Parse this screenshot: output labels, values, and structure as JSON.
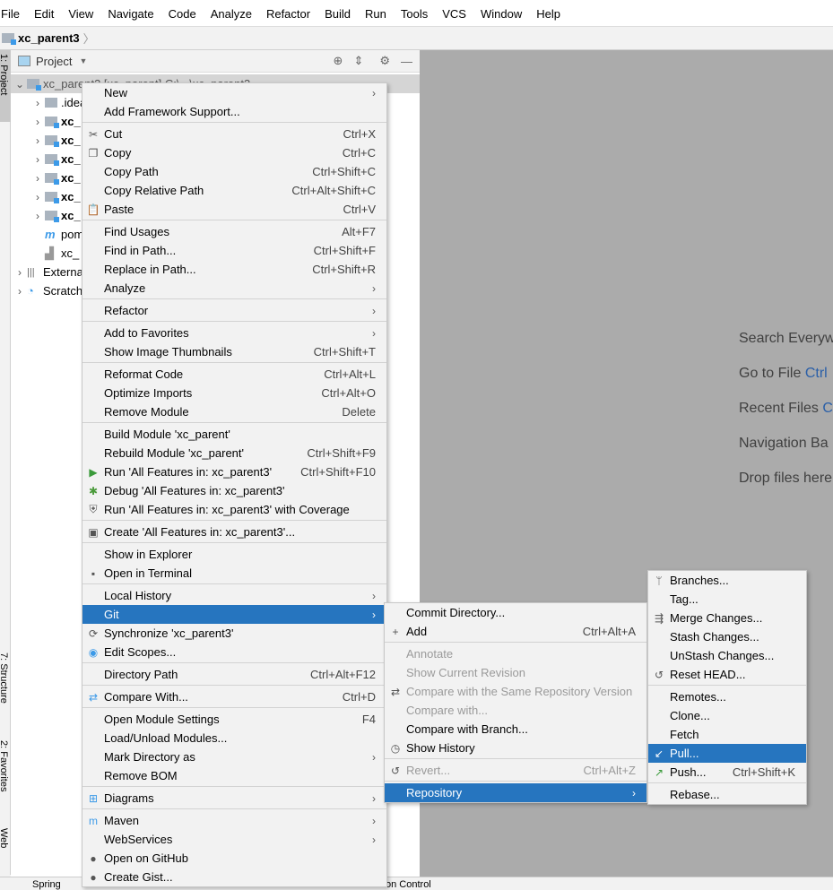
{
  "menubar": [
    "File",
    "Edit",
    "View",
    "Navigate",
    "Code",
    "Analyze",
    "Refactor",
    "Build",
    "Run",
    "Tools",
    "VCS",
    "Window",
    "Help"
  ],
  "breadcrumb": "xc_parent3",
  "left_strip": {
    "project": "1: Project",
    "structure": "7: Structure",
    "favorites": "2: Favorites",
    "web": "Web"
  },
  "project_panel": {
    "title": "Project",
    "tree": [
      {
        "label": "xc_parent3 [xc_parent] C:\\...\\xc_parent3",
        "expanded": true,
        "selected": true,
        "icon": "module-folder-icon"
      },
      {
        "label": ".idea",
        "icon": "folder-icon"
      },
      {
        "label": "xc_",
        "icon": "module-folder-icon",
        "bold": true
      },
      {
        "label": "xc_",
        "icon": "module-folder-icon",
        "bold": true
      },
      {
        "label": "xc_",
        "icon": "module-folder-icon",
        "bold": true
      },
      {
        "label": "xc_",
        "icon": "module-folder-icon",
        "bold": true
      },
      {
        "label": "xc_",
        "icon": "module-folder-icon",
        "bold": true
      },
      {
        "label": "xc_",
        "icon": "module-folder-icon",
        "bold": true
      },
      {
        "label": "pom",
        "icon": "maven-icon"
      },
      {
        "label": "xc_",
        "icon": "iml-file-icon"
      },
      {
        "label": "External",
        "icon": "library-icon",
        "root": true
      },
      {
        "label": "Scratch",
        "icon": "scratch-icon",
        "root": true
      }
    ]
  },
  "editor_hints": [
    {
      "text": "Search Everywhere",
      "key": ""
    },
    {
      "text": "Go to File ",
      "key": "Ctrl"
    },
    {
      "text": "Recent Files ",
      "key": "C"
    },
    {
      "text": "Navigation Ba",
      "key": ""
    },
    {
      "text": "Drop files here",
      "key": ""
    }
  ],
  "bottom": {
    "left": "Spring",
    "right": "on Control"
  },
  "context_menu": [
    {
      "label": "New",
      "sub": true
    },
    {
      "label": "Add Framework Support..."
    },
    {
      "sep": true
    },
    {
      "label": "Cut",
      "shortcut": "Ctrl+X",
      "icon": "✂"
    },
    {
      "label": "Copy",
      "shortcut": "Ctrl+C",
      "icon": "❐"
    },
    {
      "label": "Copy Path",
      "shortcut": "Ctrl+Shift+C"
    },
    {
      "label": "Copy Relative Path",
      "shortcut": "Ctrl+Alt+Shift+C"
    },
    {
      "label": "Paste",
      "shortcut": "Ctrl+V",
      "icon": "📋"
    },
    {
      "sep": true
    },
    {
      "label": "Find Usages",
      "shortcut": "Alt+F7"
    },
    {
      "label": "Find in Path...",
      "shortcut": "Ctrl+Shift+F"
    },
    {
      "label": "Replace in Path...",
      "shortcut": "Ctrl+Shift+R"
    },
    {
      "label": "Analyze",
      "sub": true
    },
    {
      "sep": true
    },
    {
      "label": "Refactor",
      "sub": true
    },
    {
      "sep": true
    },
    {
      "label": "Add to Favorites",
      "sub": true
    },
    {
      "label": "Show Image Thumbnails",
      "shortcut": "Ctrl+Shift+T"
    },
    {
      "sep": true
    },
    {
      "label": "Reformat Code",
      "shortcut": "Ctrl+Alt+L"
    },
    {
      "label": "Optimize Imports",
      "shortcut": "Ctrl+Alt+O"
    },
    {
      "label": "Remove Module",
      "shortcut": "Delete"
    },
    {
      "sep": true
    },
    {
      "label": "Build Module 'xc_parent'"
    },
    {
      "label": "Rebuild Module 'xc_parent'",
      "shortcut": "Ctrl+Shift+F9"
    },
    {
      "label": "Run 'All Features in: xc_parent3'",
      "shortcut": "Ctrl+Shift+F10",
      "icon": "▶",
      "color": "#3a9a3a"
    },
    {
      "label": "Debug 'All Features in: xc_parent3'",
      "icon": "✱",
      "color": "#4a9a3a"
    },
    {
      "label": "Run 'All Features in: xc_parent3' with Coverage",
      "icon": "⛨"
    },
    {
      "sep": true
    },
    {
      "label": "Create 'All Features in: xc_parent3'...",
      "icon": "▣"
    },
    {
      "sep": true
    },
    {
      "label": "Show in Explorer"
    },
    {
      "label": "Open in Terminal",
      "icon": "▪"
    },
    {
      "sep": true
    },
    {
      "label": "Local History",
      "sub": true
    },
    {
      "label": "Git",
      "sub": true,
      "highlighted": true
    },
    {
      "label": "Synchronize 'xc_parent3'",
      "icon": "⟳"
    },
    {
      "label": "Edit Scopes...",
      "icon": "◉",
      "color": "#3c9ae8"
    },
    {
      "sep": true
    },
    {
      "label": "Directory Path",
      "shortcut": "Ctrl+Alt+F12"
    },
    {
      "sep": true
    },
    {
      "label": "Compare With...",
      "shortcut": "Ctrl+D",
      "icon": "⇄",
      "color": "#3c9ae8"
    },
    {
      "sep": true
    },
    {
      "label": "Open Module Settings",
      "shortcut": "F4"
    },
    {
      "label": "Load/Unload Modules..."
    },
    {
      "label": "Mark Directory as",
      "sub": true
    },
    {
      "label": "Remove BOM"
    },
    {
      "sep": true
    },
    {
      "label": "Diagrams",
      "sub": true,
      "icon": "⊞",
      "color": "#3c9ae8"
    },
    {
      "sep": true
    },
    {
      "label": "Maven",
      "sub": true,
      "icon": "m",
      "color": "#3c9ae8"
    },
    {
      "label": "WebServices",
      "sub": true
    },
    {
      "label": "Open on GitHub",
      "icon": "●"
    },
    {
      "label": "Create Gist...",
      "icon": "●"
    }
  ],
  "git_menu": [
    {
      "label": "Commit Directory..."
    },
    {
      "label": "Add",
      "shortcut": "Ctrl+Alt+A",
      "icon": "+"
    },
    {
      "sep": true
    },
    {
      "label": "Annotate",
      "disabled": true
    },
    {
      "label": "Show Current Revision",
      "disabled": true
    },
    {
      "label": "Compare with the Same Repository Version",
      "disabled": true,
      "icon": "⇄"
    },
    {
      "label": "Compare with...",
      "disabled": true
    },
    {
      "label": "Compare with Branch..."
    },
    {
      "label": "Show History",
      "icon": "◷"
    },
    {
      "sep": true
    },
    {
      "label": "Revert...",
      "shortcut": "Ctrl+Alt+Z",
      "disabled": true,
      "icon": "↺"
    },
    {
      "sep": true
    },
    {
      "label": "Repository",
      "sub": true,
      "highlighted": true
    }
  ],
  "repository_menu": [
    {
      "label": "Branches...",
      "icon": "ᛘ"
    },
    {
      "label": "Tag..."
    },
    {
      "label": "Merge Changes...",
      "icon": "⇶"
    },
    {
      "label": "Stash Changes..."
    },
    {
      "label": "UnStash Changes..."
    },
    {
      "label": "Reset HEAD...",
      "icon": "↺"
    },
    {
      "sep": true
    },
    {
      "label": "Remotes..."
    },
    {
      "label": "Clone..."
    },
    {
      "label": "Fetch"
    },
    {
      "label": "Pull...",
      "highlighted": true,
      "icon": "↙"
    },
    {
      "label": "Push...",
      "shortcut": "Ctrl+Shift+K",
      "icon": "↗",
      "color": "#3a9a3a"
    },
    {
      "sep": true
    },
    {
      "label": "Rebase..."
    }
  ],
  "colors": {
    "highlight": "#2675bf",
    "editor_bg": "#ababab",
    "menu_bg": "#f2f2f2"
  }
}
